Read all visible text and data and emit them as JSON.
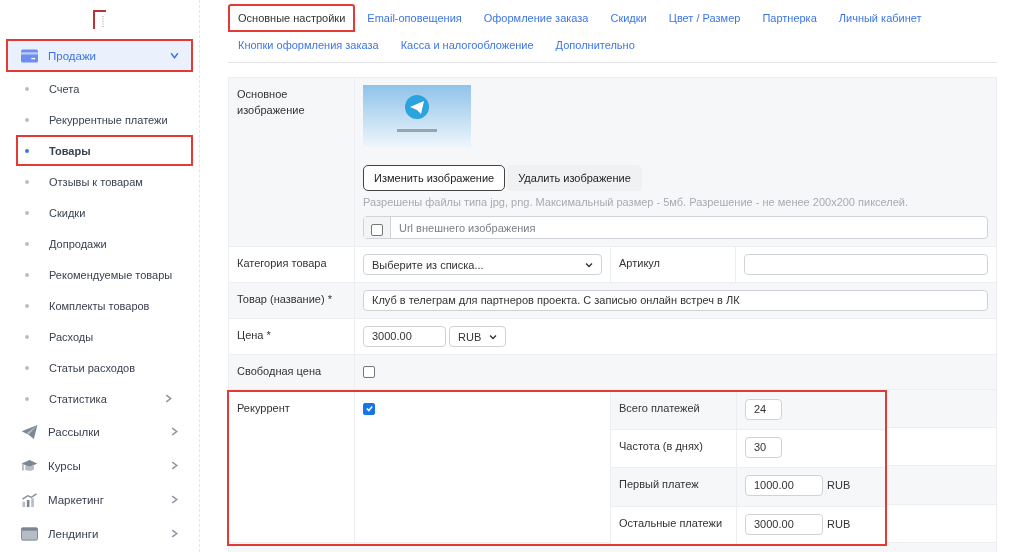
{
  "sidebar": {
    "items": [
      {
        "label": "Продажи",
        "expanded": true,
        "selected": true,
        "highlighted": true,
        "children": [
          {
            "label": "Счета",
            "selected": false,
            "highlighted": false,
            "has_submenu": false
          },
          {
            "label": "Рекуррентные платежи",
            "selected": false,
            "highlighted": false,
            "has_submenu": false
          },
          {
            "label": "Товары",
            "selected": true,
            "highlighted": true,
            "has_submenu": false
          },
          {
            "label": "Отзывы к товарам",
            "selected": false,
            "highlighted": false,
            "has_submenu": false
          },
          {
            "label": "Скидки",
            "selected": false,
            "highlighted": false,
            "has_submenu": false
          },
          {
            "label": "Допродажи",
            "selected": false,
            "highlighted": false,
            "has_submenu": false
          },
          {
            "label": "Рекомендуемые товары",
            "selected": false,
            "highlighted": false,
            "has_submenu": false
          },
          {
            "label": "Комплекты товаров",
            "selected": false,
            "highlighted": false,
            "has_submenu": false
          },
          {
            "label": "Расходы",
            "selected": false,
            "highlighted": false,
            "has_submenu": false
          },
          {
            "label": "Статьи расходов",
            "selected": false,
            "highlighted": false,
            "has_submenu": false
          },
          {
            "label": "Статистика",
            "selected": false,
            "highlighted": false,
            "has_submenu": true
          }
        ]
      },
      {
        "label": "Рассылки",
        "expanded": false,
        "selected": false,
        "highlighted": false
      },
      {
        "label": "Курсы",
        "expanded": false,
        "selected": false,
        "highlighted": false
      },
      {
        "label": "Маркетинг",
        "expanded": false,
        "selected": false,
        "highlighted": false
      },
      {
        "label": "Лендинги",
        "expanded": false,
        "selected": false,
        "highlighted": false
      }
    ]
  },
  "tab_rows": [
    [
      {
        "label": "Основные настройки",
        "selected": true,
        "highlighted": true
      },
      {
        "label": "Email-оповещения",
        "selected": false,
        "highlighted": false
      },
      {
        "label": "Оформление заказа",
        "selected": false,
        "highlighted": false
      },
      {
        "label": "Скидки",
        "selected": false,
        "highlighted": false
      },
      {
        "label": "Цвет / Размер",
        "selected": false,
        "highlighted": false
      },
      {
        "label": "Партнерка",
        "selected": false,
        "highlighted": false
      },
      {
        "label": "Личный кабинет",
        "selected": false,
        "highlighted": false
      }
    ],
    [
      {
        "label": "Кнопки оформления заказа",
        "selected": false,
        "highlighted": false
      },
      {
        "label": "Касса и налогообложение",
        "selected": false,
        "highlighted": false
      },
      {
        "label": "Дополнительно",
        "selected": false,
        "highlighted": false
      }
    ]
  ],
  "form": {
    "image": {
      "label": "Основное изображение",
      "buttons": [
        "Изменить изображение",
        "Удалить изображение"
      ],
      "hint": "Разрешены файлы типа jpg, png. Максимальный размер - 5мб. Разрешение - не менее 200x200 пикселей.",
      "url_checked": false,
      "url_placeholder": "Url внешнего изображения"
    },
    "category": {
      "label": "Категория товара",
      "value": "Выберите из списка...",
      "sku_label": "Артикул"
    },
    "name": {
      "label": "Товар (название) *",
      "value": "Клуб в телеграм для партнеров проекта. С записью онлайн встреч в ЛК"
    },
    "price": {
      "label": "Цена *",
      "value": "3000.00",
      "currency": "RUB"
    },
    "free_price": {
      "label": "Свободная цена",
      "checked": false
    },
    "recurrent": {
      "label": "Рекуррент",
      "checked": true,
      "highlighted": true,
      "fields": [
        {
          "label": "Всего платежей",
          "value": "24",
          "kind": "short"
        },
        {
          "label": "Частота (в днях)",
          "value": "30",
          "kind": "short"
        },
        {
          "label": "Первый платеж",
          "value": "1000.00",
          "kind": "money",
          "unit": "RUB"
        },
        {
          "label": "Остальные платежи",
          "value": "3000.00",
          "kind": "money",
          "unit": "RUB"
        }
      ]
    }
  }
}
